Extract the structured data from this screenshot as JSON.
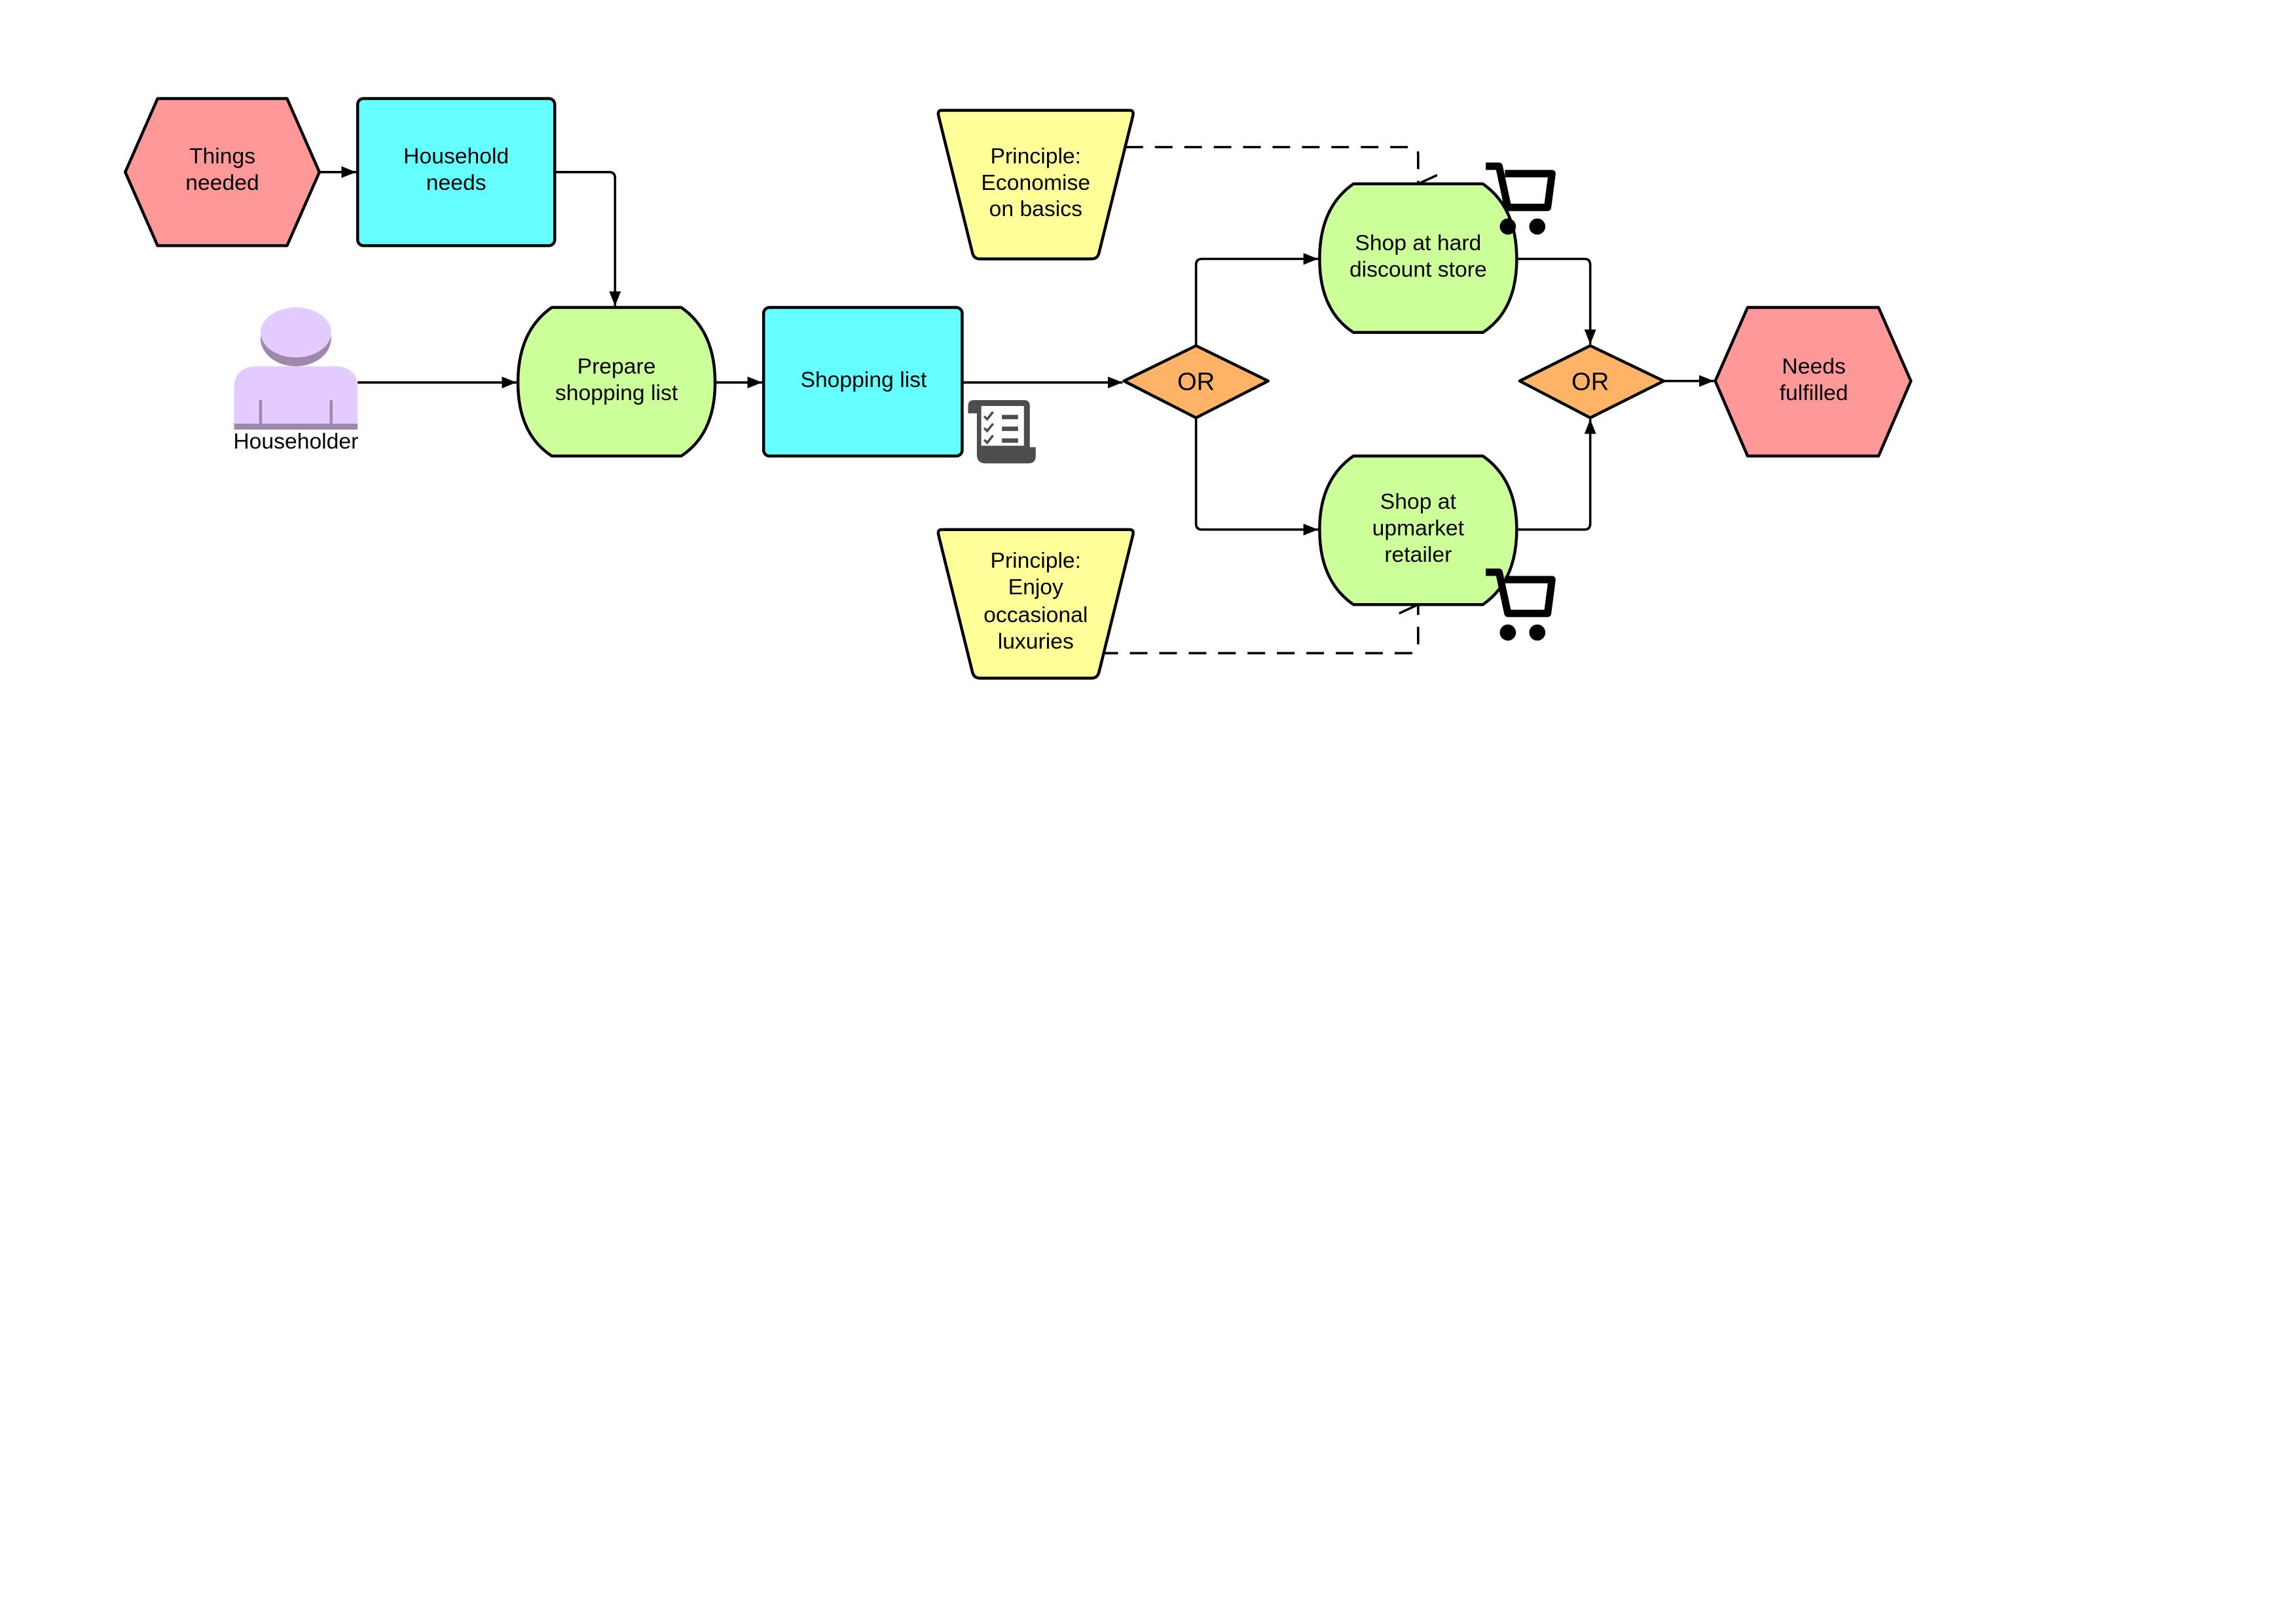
{
  "colors": {
    "event": "#ff9999",
    "information": "#66ffff",
    "function": "#ccff99",
    "principle": "#ffff99",
    "connector": "#ffb366",
    "person": "#e3ccff",
    "person_shadow": "#9f88aa"
  },
  "nodes": {
    "things_needed": [
      "Things",
      "needed"
    ],
    "household_needs": [
      "Household",
      "needs"
    ],
    "householder": "Householder",
    "prepare_list": [
      "Prepare",
      "shopping list"
    ],
    "shopping_list": "Shopping list",
    "or_split": "OR",
    "principle_basics": [
      "Principle:",
      "Economise",
      "on basics"
    ],
    "principle_luxuries": [
      "Principle:",
      "Enjoy",
      "occasional",
      "luxuries"
    ],
    "hard_discount": [
      "Shop at hard",
      "discount store"
    ],
    "upmarket": [
      "Shop at",
      "upmarket",
      "retailer"
    ],
    "or_join": "OR",
    "needs_fulfilled": [
      "Needs",
      "fulfilled"
    ]
  },
  "icons": {
    "person": "person-icon",
    "document": "checklist-document-icon",
    "cart": "shopping-cart-icon"
  }
}
